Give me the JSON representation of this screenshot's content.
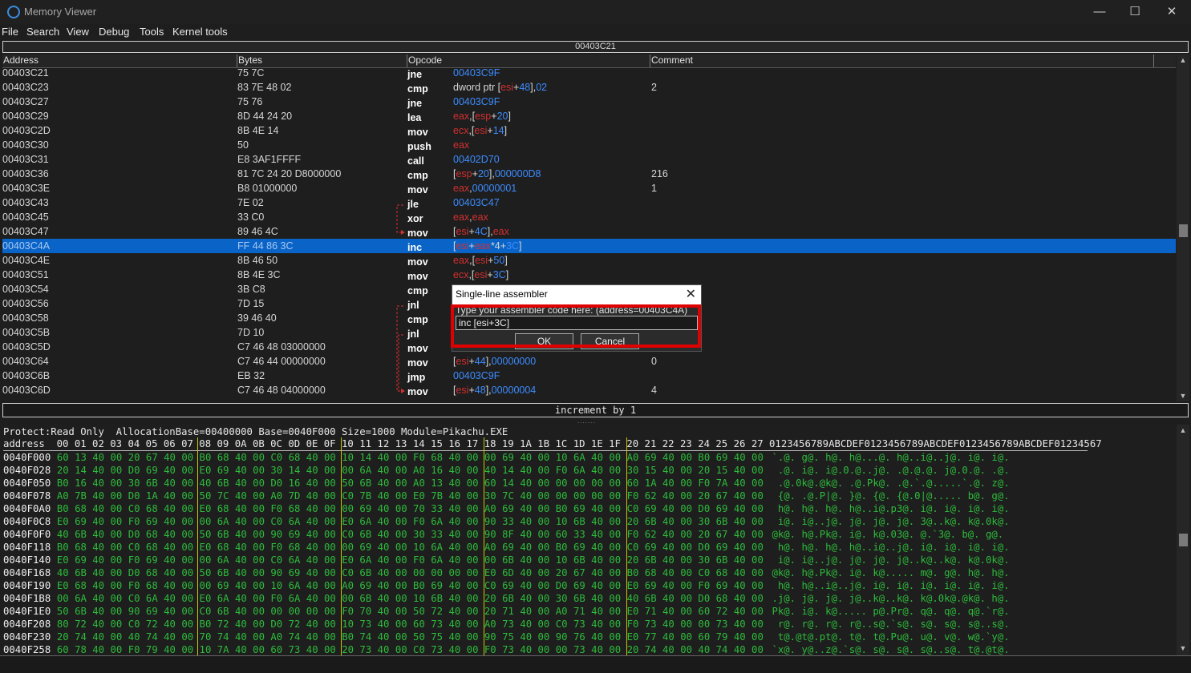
{
  "window": {
    "title": "Memory Viewer",
    "minimize": "—",
    "maximize": "☐",
    "close": "✕"
  },
  "menu": [
    "File",
    "Search",
    "View",
    "Debug",
    "Tools",
    "Kernel tools"
  ],
  "disassembler": {
    "address_bar": "00403C21",
    "columns": [
      "Address",
      "Bytes",
      "Opcode",
      "Comment"
    ],
    "rows": [
      {
        "address": "00403C21",
        "bytes": "75 7C",
        "mnemonic": "jne",
        "operand": [
          {
            "t": "00403C9F",
            "k": "num"
          }
        ],
        "comment": ""
      },
      {
        "address": "00403C23",
        "bytes": "83 7E 48 02",
        "mnemonic": "cmp",
        "operand": [
          {
            "t": "dword ptr [",
            "k": "tx"
          },
          {
            "t": "esi",
            "k": "reg"
          },
          {
            "t": "+",
            "k": "tx"
          },
          {
            "t": "48",
            "k": "num"
          },
          {
            "t": "],",
            "k": "tx"
          },
          {
            "t": "02",
            "k": "num"
          }
        ],
        "comment": "2"
      },
      {
        "address": "00403C27",
        "bytes": "75 76",
        "mnemonic": "jne",
        "operand": [
          {
            "t": "00403C9F",
            "k": "num"
          }
        ],
        "comment": ""
      },
      {
        "address": "00403C29",
        "bytes": "8D 44 24 20",
        "mnemonic": "lea",
        "operand": [
          {
            "t": "eax",
            "k": "reg"
          },
          {
            "t": ",[",
            "k": "tx"
          },
          {
            "t": "esp",
            "k": "reg"
          },
          {
            "t": "+",
            "k": "tx"
          },
          {
            "t": "20",
            "k": "num"
          },
          {
            "t": "]",
            "k": "tx"
          }
        ],
        "comment": ""
      },
      {
        "address": "00403C2D",
        "bytes": "8B 4E 14",
        "mnemonic": "mov",
        "operand": [
          {
            "t": "ecx",
            "k": "reg"
          },
          {
            "t": ",[",
            "k": "tx"
          },
          {
            "t": "esi",
            "k": "reg"
          },
          {
            "t": "+",
            "k": "tx"
          },
          {
            "t": "14",
            "k": "num"
          },
          {
            "t": "]",
            "k": "tx"
          }
        ],
        "comment": ""
      },
      {
        "address": "00403C30",
        "bytes": "50",
        "mnemonic": "push",
        "operand": [
          {
            "t": "eax",
            "k": "reg"
          }
        ],
        "comment": ""
      },
      {
        "address": "00403C31",
        "bytes": "E8 3AF1FFFF",
        "mnemonic": "call",
        "operand": [
          {
            "t": "00402D70",
            "k": "num"
          }
        ],
        "comment": ""
      },
      {
        "address": "00403C36",
        "bytes": "81 7C 24 20 D8000000",
        "mnemonic": "cmp",
        "operand": [
          {
            "t": "[",
            "k": "tx"
          },
          {
            "t": "esp",
            "k": "reg"
          },
          {
            "t": "+",
            "k": "tx"
          },
          {
            "t": "20",
            "k": "num"
          },
          {
            "t": "],",
            "k": "tx"
          },
          {
            "t": "000000D8",
            "k": "num"
          }
        ],
        "comment": "216"
      },
      {
        "address": "00403C3E",
        "bytes": "B8 01000000",
        "mnemonic": "mov",
        "operand": [
          {
            "t": "eax",
            "k": "reg"
          },
          {
            "t": ",",
            "k": "tx"
          },
          {
            "t": "00000001",
            "k": "num"
          }
        ],
        "comment": "1"
      },
      {
        "address": "00403C43",
        "bytes": "7E 02",
        "mnemonic": "jle",
        "operand": [
          {
            "t": "00403C47",
            "k": "num"
          }
        ],
        "comment": ""
      },
      {
        "address": "00403C45",
        "bytes": "33 C0",
        "mnemonic": "xor",
        "operand": [
          {
            "t": "eax",
            "k": "reg"
          },
          {
            "t": ",",
            "k": "tx"
          },
          {
            "t": "eax",
            "k": "reg"
          }
        ],
        "comment": ""
      },
      {
        "address": "00403C47",
        "bytes": "89 46 4C",
        "mnemonic": "mov",
        "operand": [
          {
            "t": "[",
            "k": "tx"
          },
          {
            "t": "esi",
            "k": "reg"
          },
          {
            "t": "+",
            "k": "tx"
          },
          {
            "t": "4C",
            "k": "num"
          },
          {
            "t": "],",
            "k": "tx"
          },
          {
            "t": "eax",
            "k": "reg"
          }
        ],
        "comment": ""
      },
      {
        "address": "00403C4A",
        "bytes": "FF 44 86 3C",
        "mnemonic": "inc",
        "operand": [
          {
            "t": "[",
            "k": "tx"
          },
          {
            "t": "esi",
            "k": "reg"
          },
          {
            "t": "+",
            "k": "tx"
          },
          {
            "t": "eax",
            "k": "reg"
          },
          {
            "t": "*4+",
            "k": "tx"
          },
          {
            "t": "3C",
            "k": "num"
          },
          {
            "t": "]",
            "k": "tx"
          }
        ],
        "comment": "",
        "selected": true
      },
      {
        "address": "00403C4E",
        "bytes": "8B 46 50",
        "mnemonic": "mov",
        "operand": [
          {
            "t": "eax",
            "k": "reg"
          },
          {
            "t": ",[",
            "k": "tx"
          },
          {
            "t": "esi",
            "k": "reg"
          },
          {
            "t": "+",
            "k": "tx"
          },
          {
            "t": "50",
            "k": "num"
          },
          {
            "t": "]",
            "k": "tx"
          }
        ],
        "comment": ""
      },
      {
        "address": "00403C51",
        "bytes": "8B 4E 3C",
        "mnemonic": "mov",
        "operand": [
          {
            "t": "ecx",
            "k": "reg"
          },
          {
            "t": ",[",
            "k": "tx"
          },
          {
            "t": "esi",
            "k": "reg"
          },
          {
            "t": "+",
            "k": "tx"
          },
          {
            "t": "3C",
            "k": "num"
          },
          {
            "t": "]",
            "k": "tx"
          }
        ],
        "comment": ""
      },
      {
        "address": "00403C54",
        "bytes": "3B C8",
        "mnemonic": "cmp",
        "operand": [],
        "comment": ""
      },
      {
        "address": "00403C56",
        "bytes": "7D 15",
        "mnemonic": "jnl",
        "operand": [],
        "comment": ""
      },
      {
        "address": "00403C58",
        "bytes": "39 46 40",
        "mnemonic": "cmp",
        "operand": [],
        "comment": ""
      },
      {
        "address": "00403C5B",
        "bytes": "7D 10",
        "mnemonic": "jnl",
        "operand": [],
        "comment": ""
      },
      {
        "address": "00403C5D",
        "bytes": "C7 46 48 03000000",
        "mnemonic": "mov",
        "operand": [],
        "comment": ""
      },
      {
        "address": "00403C64",
        "bytes": "C7 46 44 00000000",
        "mnemonic": "mov",
        "operand": [
          {
            "t": "[",
            "k": "tx"
          },
          {
            "t": "esi",
            "k": "reg"
          },
          {
            "t": "+",
            "k": "tx"
          },
          {
            "t": "44",
            "k": "num"
          },
          {
            "t": "],",
            "k": "tx"
          },
          {
            "t": "00000000",
            "k": "num"
          }
        ],
        "comment": "0"
      },
      {
        "address": "00403C6B",
        "bytes": "EB 32",
        "mnemonic": "jmp",
        "operand": [
          {
            "t": "00403C9F",
            "k": "num"
          }
        ],
        "comment": ""
      },
      {
        "address": "00403C6D",
        "bytes": "C7 46 48 04000000",
        "mnemonic": "mov",
        "operand": [
          {
            "t": "[",
            "k": "tx"
          },
          {
            "t": "esi",
            "k": "reg"
          },
          {
            "t": "+",
            "k": "tx"
          },
          {
            "t": "48",
            "k": "num"
          },
          {
            "t": "],",
            "k": "tx"
          },
          {
            "t": "00000004",
            "k": "num"
          }
        ],
        "comment": "4"
      }
    ],
    "status": "increment by 1"
  },
  "hexview": {
    "info": "Protect:Read Only  AllocationBase=00400000 Base=0040F000 Size=1000 Module=Pikachu.EXE",
    "header": "address  00 01 02 03 04 05 06 07 08 09 0A 0B 0C 0D 0E 0F 10 11 12 13 14 15 16 17 18 19 1A 1B 1C 1D 1E 1F 20 21 22 23 24 25 26 27 0123456789ABCDEF0123456789ABCDEF0123456789ABCDEF01234567",
    "rows": [
      {
        "addr": "0040F000",
        "bytes": "60 13 40 00 20 67 40 00 B0 68 40 00 C0 68 40 00 10 14 40 00 F0 68 40 00 00 69 40 00 10 6A 40 00 A0 69 40 00 B0 69 40 00",
        "ascii": "`.@. g@. h@. h@...@. h@..i@..j@. i@. i@."
      },
      {
        "addr": "0040F028",
        "bytes": "20 14 40 00 D0 69 40 00 E0 69 40 00 30 14 40 00 00 6A 40 00 A0 16 40 00 40 14 40 00 F0 6A 40 00 30 15 40 00 20 15 40 00",
        "ascii": " .@. i@. i@.0.@..j@. .@.@.@. j@.0.@. .@."
      },
      {
        "addr": "0040F050",
        "bytes": "B0 16 40 00 30 6B 40 00 40 6B 40 00 D0 16 40 00 50 6B 40 00 A0 13 40 00 60 14 40 00 00 00 00 00 60 1A 40 00 F0 7A 40 00",
        "ascii": " .@.0k@.@k@. .@.Pk@. .@.`.@.....`.@. z@."
      },
      {
        "addr": "0040F078",
        "bytes": "A0 7B 40 00 D0 1A 40 00 50 7C 40 00 A0 7D 40 00 C0 7B 40 00 E0 7B 40 00 30 7C 40 00 00 00 00 00 F0 62 40 00 20 67 40 00",
        "ascii": " {@. .@.P|@. }@. {@. {@.0|@..... b@. g@."
      },
      {
        "addr": "0040F0A0",
        "bytes": "B0 68 40 00 C0 68 40 00 E0 68 40 00 F0 68 40 00 00 69 40 00 70 33 40 00 A0 69 40 00 B0 69 40 00 C0 69 40 00 D0 69 40 00",
        "ascii": " h@. h@. h@. h@..i@.p3@. i@. i@. i@. i@."
      },
      {
        "addr": "0040F0C8",
        "bytes": "E0 69 40 00 F0 69 40 00 00 6A 40 00 C0 6A 40 00 E0 6A 40 00 F0 6A 40 00 90 33 40 00 10 6B 40 00 20 6B 40 00 30 6B 40 00",
        "ascii": " i@. i@..j@. j@. j@. j@. 3@..k@. k@.0k@."
      },
      {
        "addr": "0040F0F0",
        "bytes": "40 6B 40 00 D0 68 40 00 50 6B 40 00 90 69 40 00 C0 6B 40 00 30 33 40 00 90 8F 40 00 60 33 40 00 F0 62 40 00 20 67 40 00",
        "ascii": "@k@. h@.Pk@. i@. k@.03@. @.`3@. b@. g@."
      },
      {
        "addr": "0040F118",
        "bytes": "B0 68 40 00 C0 68 40 00 E0 68 40 00 F0 68 40 00 00 69 40 00 10 6A 40 00 A0 69 40 00 B0 69 40 00 C0 69 40 00 D0 69 40 00",
        "ascii": " h@. h@. h@. h@..i@..j@. i@. i@. i@. i@."
      },
      {
        "addr": "0040F140",
        "bytes": "E0 69 40 00 F0 69 40 00 00 6A 40 00 C0 6A 40 00 E0 6A 40 00 F0 6A 40 00 00 6B 40 00 10 6B 40 00 20 6B 40 00 30 6B 40 00",
        "ascii": " i@. i@..j@. j@. j@. j@..k@..k@. k@.0k@."
      },
      {
        "addr": "0040F168",
        "bytes": "40 6B 40 00 D0 68 40 00 50 6B 40 00 90 69 40 00 C0 6B 40 00 00 00 00 00 E0 6D 40 00 20 67 40 00 B0 68 40 00 C0 68 40 00",
        "ascii": "@k@. h@.Pk@. i@. k@..... m@. g@. h@. h@."
      },
      {
        "addr": "0040F190",
        "bytes": "E0 68 40 00 F0 68 40 00 00 69 40 00 10 6A 40 00 A0 69 40 00 B0 69 40 00 C0 69 40 00 D0 69 40 00 E0 69 40 00 F0 69 40 00",
        "ascii": " h@. h@..i@..j@. i@. i@. i@. i@. i@. i@."
      },
      {
        "addr": "0040F1B8",
        "bytes": "00 6A 40 00 C0 6A 40 00 E0 6A 40 00 F0 6A 40 00 00 6B 40 00 10 6B 40 00 20 6B 40 00 30 6B 40 00 40 6B 40 00 D0 68 40 00",
        "ascii": ".j@. j@. j@. j@..k@..k@. k@.0k@.@k@. h@."
      },
      {
        "addr": "0040F1E0",
        "bytes": "50 6B 40 00 90 69 40 00 C0 6B 40 00 00 00 00 00 F0 70 40 00 50 72 40 00 20 71 40 00 A0 71 40 00 E0 71 40 00 60 72 40 00",
        "ascii": "Pk@. i@. k@..... p@.Pr@. q@. q@. q@.`r@."
      },
      {
        "addr": "0040F208",
        "bytes": "80 72 40 00 C0 72 40 00 B0 72 40 00 D0 72 40 00 10 73 40 00 60 73 40 00 A0 73 40 00 C0 73 40 00 F0 73 40 00 00 73 40 00",
        "ascii": " r@. r@. r@. r@..s@.`s@. s@. s@. s@..s@."
      },
      {
        "addr": "0040F230",
        "bytes": "20 74 40 00 40 74 40 00 70 74 40 00 A0 74 40 00 B0 74 40 00 50 75 40 00 90 75 40 00 90 76 40 00 E0 77 40 00 60 79 40 00",
        "ascii": " t@.@t@.pt@. t@. t@.Pu@. u@. v@. w@.`y@."
      },
      {
        "addr": "0040F258",
        "bytes": "60 78 40 00 F0 79 40 00 10 7A 40 00 60 73 40 00 20 73 40 00 C0 73 40 00 F0 73 40 00 00 73 40 00 20 74 40 00 40 74 40 00",
        "ascii": "`x@. y@..z@.`s@. s@. s@. s@..s@. t@.@t@."
      }
    ]
  },
  "dialog": {
    "title": "Single-line assembler",
    "prompt": "Type your assembler code here: (address=00403C4A)",
    "input_value": "inc [esi+3C]",
    "ok_label": "OK",
    "cancel_label": "Cancel",
    "close_glyph": "✕"
  },
  "colors": {
    "selected_row": "#0a64c8",
    "register": "#d23030",
    "number": "#3c8cff",
    "hex_bytes": "#2dbb3b",
    "highlight": "#e00000"
  }
}
